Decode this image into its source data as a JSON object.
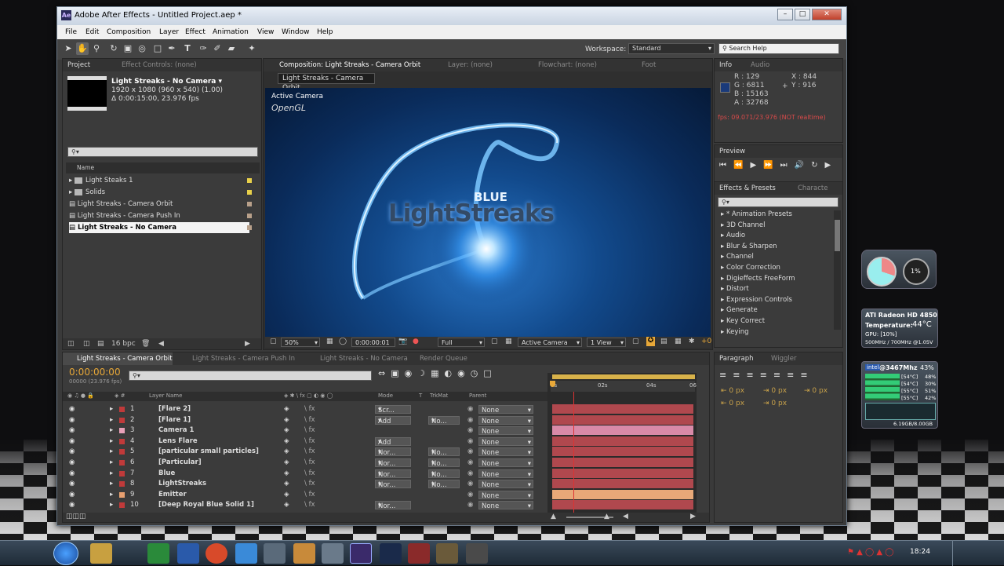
{
  "window": {
    "title": "Adobe After Effects - Untitled Project.aep *",
    "app_icon": "Ae",
    "min": "–",
    "max": "□",
    "close": "✕"
  },
  "menu": [
    "File",
    "Edit",
    "Composition",
    "Layer",
    "Effect",
    "Animation",
    "View",
    "Window",
    "Help"
  ],
  "toolbar": {
    "workspace_label": "Workspace:",
    "workspace_value": "Standard",
    "search_placeholder": "Search Help"
  },
  "project": {
    "tab": "Project",
    "tab2": "Effect Controls: (none)",
    "comp_name": "Light Streaks - No Camera ▾",
    "comp_info1": "1920 x 1080  (960 x 540) (1.00)",
    "comp_info2": "Δ 0:00:15:00, 23.976 fps",
    "col_name": "Name",
    "items": [
      "Light Steaks 1",
      "Solids",
      "Light Streaks - Camera Orbit",
      "Light Streaks - Camera Push In",
      "Light Streaks - No Camera"
    ],
    "bpc": "16 bpc"
  },
  "comp_panel": {
    "tab": "Composition: Light Streaks - Camera Orbit",
    "tab_layer": "Layer: (none)",
    "tab_flow": "Flowchart: (none)",
    "tab_foot": "Foot",
    "subtab": "Light Streaks - Camera Orbit",
    "camera": "Active Camera",
    "renderer": "OpenGL",
    "logo_small": "BLUE",
    "logo_big": "LightStreaks",
    "zoom": "50%",
    "timecode": "0:00:00:01",
    "quality": "Full",
    "view_camera": "Active Camera",
    "views": "1 View",
    "offset": "+0"
  },
  "info": {
    "tab": "Info",
    "tab2": "Audio",
    "r": "R : 129",
    "g": "G : 6811",
    "b": "B : 15163",
    "a": "A : 32768",
    "x": "X : 844",
    "y": "Y : 916",
    "fps": "fps: 09.071/23.976 (NOT realtime)",
    "swatch": "#1a3a7a"
  },
  "preview": {
    "tab": "Preview"
  },
  "effects": {
    "tab": "Effects & Presets",
    "tab2": "Characte",
    "items": [
      "* Animation Presets",
      "3D Channel",
      "Audio",
      "Blur & Sharpen",
      "Channel",
      "Color Correction",
      "Digieffects FreeForm",
      "Distort",
      "Expression Controls",
      "Generate",
      "Key Correct",
      "Keying"
    ]
  },
  "paragraph": {
    "tab": "Paragraph",
    "tab2": "Wiggler",
    "px": [
      "0 px",
      "0 px",
      "0 px",
      "0 px",
      "0 px"
    ]
  },
  "timeline": {
    "tabs": [
      "Light Streaks - Camera Orbit",
      "Light Streaks - Camera Push In",
      "Light Streaks - No Camera",
      "Render Queue"
    ],
    "timecode": "0:00:00:00",
    "frames": "00000 (23.976 fps)",
    "col_layer": "Layer Name",
    "col_mode": "Mode",
    "col_t": "T",
    "col_trk": "TrkMat",
    "col_parent": "Parent",
    "ruler": [
      "0s",
      "02s",
      "04s",
      "06"
    ],
    "layers": [
      {
        "n": "1",
        "name": "[Flare 2]",
        "mode": "Scr...",
        "trk": "",
        "parent": "None",
        "label": "#c03a3a",
        "bar": "#b0484e"
      },
      {
        "n": "2",
        "name": "[Flare 1]",
        "mode": "Add",
        "trk": "No...",
        "parent": "None",
        "label": "#c03a3a",
        "bar": "#b0484e"
      },
      {
        "n": "3",
        "name": "Camera 1",
        "mode": "",
        "trk": "",
        "parent": "None",
        "label": "#e8a0b8",
        "bar": "#d98aa8"
      },
      {
        "n": "4",
        "name": "Lens Flare",
        "mode": "Add",
        "trk": "",
        "parent": "None",
        "label": "#c03a3a",
        "bar": "#b0484e"
      },
      {
        "n": "5",
        "name": "[particular small particles]",
        "mode": "Nor...",
        "trk": "No...",
        "parent": "None",
        "label": "#c03a3a",
        "bar": "#b0484e"
      },
      {
        "n": "6",
        "name": "[Particular]",
        "mode": "Nor...",
        "trk": "No...",
        "parent": "None",
        "label": "#c03a3a",
        "bar": "#b0484e"
      },
      {
        "n": "7",
        "name": "Blue",
        "mode": "Nor...",
        "trk": "No...",
        "parent": "None",
        "label": "#c03a3a",
        "bar": "#b0484e"
      },
      {
        "n": "8",
        "name": "LightStreaks",
        "mode": "Nor...",
        "trk": "No...",
        "parent": "None",
        "label": "#c03a3a",
        "bar": "#b0484e"
      },
      {
        "n": "9",
        "name": "Emitter",
        "mode": "",
        "trk": "",
        "parent": "None",
        "label": "#e8a070",
        "bar": "#e8a878"
      },
      {
        "n": "10",
        "name": "[Deep Royal Blue Solid 1]",
        "mode": "Nor...",
        "trk": "",
        "parent": "None",
        "label": "#c03a3a",
        "bar": "#b0484e"
      }
    ]
  },
  "gadgets": {
    "cpu_pct": "1%",
    "gpu_name": "ATI Radeon HD 4850",
    "gpu_temp_label": "Temperature:",
    "gpu_temp": "44°C",
    "gpu_load": "GPU: [10%]",
    "gpu_clock": "500MHz / 700MHz @1.05V",
    "cpu_title": "@3467Mhz",
    "cpu_load": "43%",
    "cores": [
      {
        "t": "[54°C]",
        "p": "48%"
      },
      {
        "t": "[54°C]",
        "p": "30%"
      },
      {
        "t": "[55°C]",
        "p": "51%"
      },
      {
        "t": "[55°C]",
        "p": "42%"
      }
    ],
    "mem": "6.19GB/8.00GB"
  },
  "taskbar": {
    "clock": "18:24"
  }
}
